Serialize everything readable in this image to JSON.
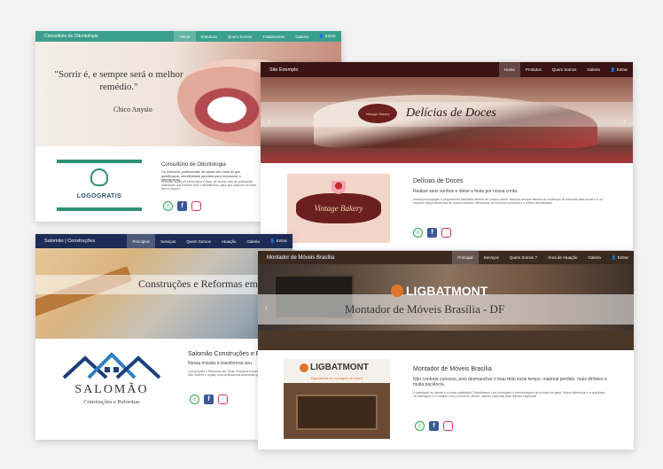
{
  "dental": {
    "brand": "Consultório de Odontologia",
    "menu": [
      "Home",
      "Estrutura",
      "Quem Somos",
      "Tratamentos",
      "Galeria",
      "👤 Entrar"
    ],
    "quote": "\"Sorrir é, e sempre será o melhor remédio.\"",
    "author": "Chico Anysio",
    "logo_text": "LOGOGRATIS",
    "heading": "Consultório de Odontologia",
    "sub": "Os melhores profissionais de saúde são mais do que qualificados, sensibilidade apurada para humanizar o atendimento.",
    "body": "Executar ações de forma ética e clara, de acordo com as qualidades individuais que formam todo o atendimento, para que cada um se sinta bem e seguro."
  },
  "cakes": {
    "brand": "Site Exemplo",
    "menu": [
      "Home",
      "Produtos",
      "Quem Somos",
      "Galeria",
      "👤 Entrar"
    ],
    "hero_title": "Delícias de Doces",
    "badge_text": "Vintage Bakery",
    "logo_text": "Vintage Bakery",
    "heading": "Delícias de Doces",
    "sub": "Realize seus sonhos e deixe a festa por nossa conta.",
    "body": "Nossa preocupação é proporcionar felicidade através de nossos doces, estamos sempre atentos às mudanças do mercado para inovar e ir ao encontro das preferências de nossos clientes, oferecendo os melhores produtos e o melhor atendimento."
  },
  "construction": {
    "brand": "Salomão | Construções",
    "menu": [
      "Princípios",
      "Serviços",
      "Quem Somos",
      "Atuação",
      "Galeria",
      "👤 Entrar"
    ],
    "hero_title": "Construções e Reformas em G",
    "logo_name": "SALOMÃO",
    "logo_tag": "Construções e Reformas",
    "heading": "Salomão Construções e R",
    "sub": "Nossa missão é transformar seu",
    "body": "Construções e Reformas em Geral. Empresa formada por profissionais de São Vicente e região, com profissionais altamente qualificados."
  },
  "furniture": {
    "brand": "Montador de Móveis Brasília",
    "menu": [
      "Principal",
      "Serviços",
      "Quem Somos ?",
      "Área de Atuação",
      "Galeria",
      "👤 Entrar"
    ],
    "hero_logo": "LIGBATMONT",
    "hero_title": "Montador de Móveis Brasília - DF",
    "thumb_logo": "LIGBATMONT",
    "thumb_tag": "Especialistas em montagem de móveis",
    "heading": "Montador de Móveis Brasília",
    "sub": "Não contrate curiosos, pois desmanchar o mau feito inclui tempo, material perdido, mais dinheiro e muita paciência.",
    "body": "A satisfação do cliente é a nossa satisfação! Trabalhamos com montagem e desmontagem de móveis em geral. Nosso diferencial é a qualidade na montagem e o cuidado com o móvel do cliente. Valores especiais para clientes especiais!"
  },
  "social_icons": [
    "whatsapp-icon",
    "facebook-icon",
    "instagram-icon"
  ],
  "colors": {
    "dental_nav": "#3a9f8c",
    "cakes_nav": "#3a1412",
    "construction_nav": "#1d2b55",
    "furniture_nav": "#3b2a1f",
    "arrow": "#ffffff"
  }
}
